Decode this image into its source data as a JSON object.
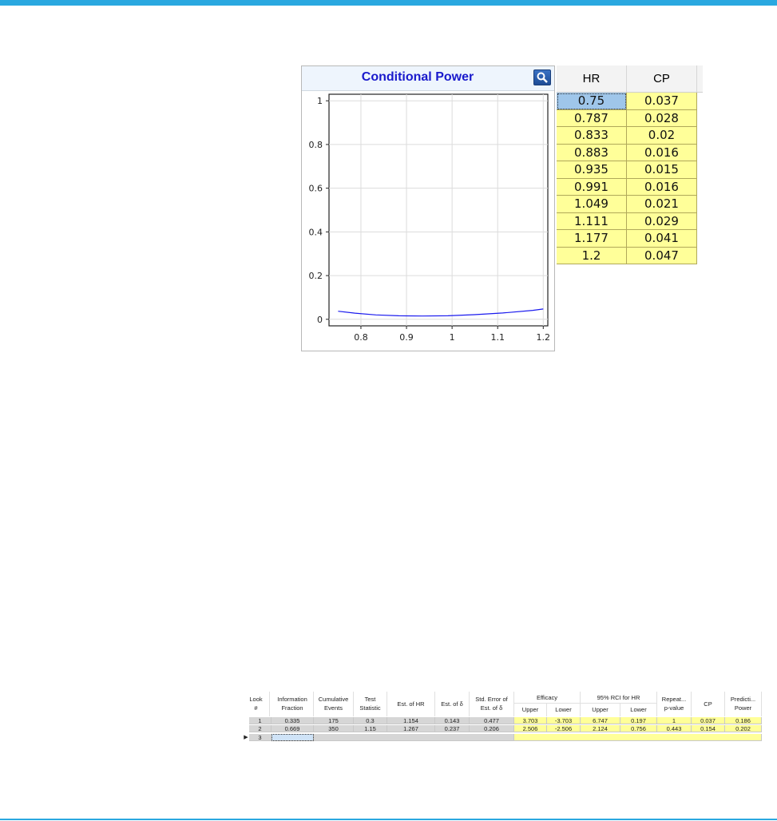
{
  "chart": {
    "title": "Conditional Power",
    "zoom_icon": "magnifier-icon",
    "line_color": "#1a1aee"
  },
  "chart_data": {
    "type": "line",
    "title": "Conditional Power",
    "x": [
      0.75,
      0.787,
      0.833,
      0.883,
      0.935,
      0.991,
      1.049,
      1.111,
      1.177,
      1.2
    ],
    "series": [
      {
        "values": [
          0.037,
          0.028,
          0.02,
          0.016,
          0.015,
          0.016,
          0.021,
          0.029,
          0.041,
          0.047
        ]
      }
    ],
    "xticks": [
      "0.8",
      "0.9",
      "1",
      "1.1",
      "1.2"
    ],
    "yticks": [
      "0",
      "0.2",
      "0.4",
      "0.6",
      "0.8",
      "1"
    ],
    "xlim": [
      0.73,
      1.21
    ],
    "ylim": [
      -0.03,
      1.03
    ],
    "grid": true
  },
  "cp_table": {
    "headers": [
      "HR",
      "CP"
    ],
    "rows": [
      [
        "0.75",
        "0.037"
      ],
      [
        "0.787",
        "0.028"
      ],
      [
        "0.833",
        "0.02"
      ],
      [
        "0.883",
        "0.016"
      ],
      [
        "0.935",
        "0.015"
      ],
      [
        "0.991",
        "0.016"
      ],
      [
        "1.049",
        "0.021"
      ],
      [
        "1.111",
        "0.029"
      ],
      [
        "1.177",
        "0.041"
      ],
      [
        "1.2",
        "0.047"
      ]
    ]
  },
  "grid": {
    "headers": {
      "look": [
        "Look",
        "#"
      ],
      "info": [
        "Information",
        "Fraction"
      ],
      "events": [
        "Cumulative",
        "Events"
      ],
      "test": [
        "Test",
        "Statistic"
      ],
      "esthr": "Est. of HR",
      "estd": "Est. of δ",
      "stderr": [
        "Std. Error of",
        "Est. of δ"
      ],
      "efficacy": "Efficacy",
      "eff_upper": "Upper",
      "eff_lower": "Lower",
      "rci": "95% RCI for HR",
      "rci_upper": "Upper",
      "rci_lower": "Lower",
      "repeat": [
        "Repeat...",
        "p-value"
      ],
      "cp": "CP",
      "pred": [
        "Predicti...",
        "Power"
      ]
    },
    "rows": [
      [
        "1",
        "0.335",
        "175",
        "0.3",
        "1.154",
        "0.143",
        "0.477",
        "3.703",
        "-3.703",
        "6.747",
        "0.197",
        "1",
        "0.037",
        "0.186"
      ],
      [
        "2",
        "0.669",
        "350",
        "1.15",
        "1.267",
        "0.237",
        "0.206",
        "2.506",
        "-2.506",
        "2.124",
        "0.756",
        "0.443",
        "0.154",
        "0.202"
      ]
    ],
    "new_row_look": "3"
  }
}
